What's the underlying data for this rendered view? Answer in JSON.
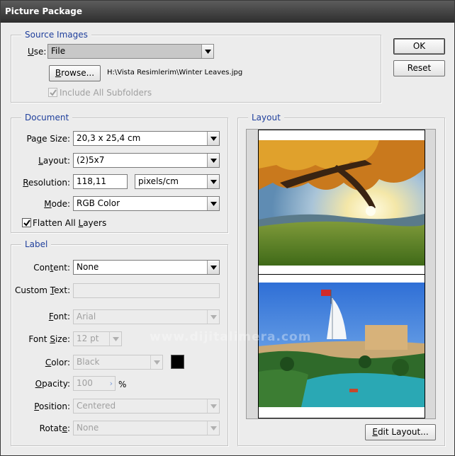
{
  "window": {
    "title": "Picture Package"
  },
  "buttons": {
    "ok": "OK",
    "reset": "Reset",
    "browse": "Browse...",
    "edit_layout": "Edit Layout..."
  },
  "source_images": {
    "legend": "Source Images",
    "use_label": "Use:",
    "use_value": "File",
    "file_path": "H:\\Vista Resimlerim\\Winter Leaves.jpg",
    "include_subfolders_label": "Include All Subfolders",
    "include_subfolders_checked": true
  },
  "document": {
    "legend": "Document",
    "page_size_label": "Page Size:",
    "page_size_value": "20,3 x 25,4 cm",
    "layout_label": "Layout:",
    "layout_value": "(2)5x7",
    "resolution_label": "Resolution:",
    "resolution_value": "118,11",
    "resolution_unit": "pixels/cm",
    "mode_label": "Mode:",
    "mode_value": "RGB Color",
    "flatten_label": "Flatten All Layers",
    "flatten_checked": true
  },
  "label": {
    "legend": "Label",
    "content_label": "Content:",
    "content_value": "None",
    "custom_text_label": "Custom Text:",
    "custom_text_value": "",
    "font_label": "Font:",
    "font_value": "Arial",
    "font_size_label": "Font Size:",
    "font_size_value": "12 pt",
    "color_label": "Color:",
    "color_value": "Black",
    "color_swatch": "#000000",
    "opacity_label": "Opacity:",
    "opacity_value": "100",
    "opacity_unit": "%",
    "position_label": "Position:",
    "position_value": "Centered",
    "rotate_label": "Rotate:",
    "rotate_value": "None"
  },
  "layout_panel": {
    "legend": "Layout",
    "images": [
      "autumn-tree-landscape-photo",
      "dubai-resort-burj-al-arab-photo"
    ],
    "watermark": "www.dijitalimera.com"
  },
  "colors": {
    "legend_blue": "#1f3f9c",
    "titlebar": "#3a3a3a"
  }
}
